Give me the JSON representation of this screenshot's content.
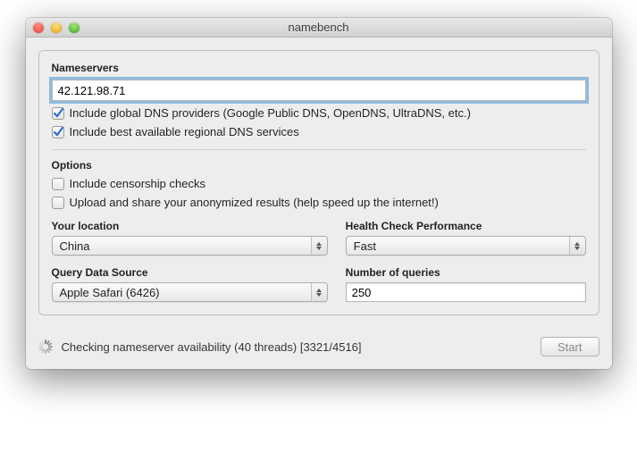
{
  "window": {
    "title": "namebench"
  },
  "nameservers": {
    "label": "Nameservers",
    "value": "42.121.98.71",
    "include_global": {
      "checked": true,
      "label": "Include global DNS providers (Google Public DNS, OpenDNS, UltraDNS, etc.)"
    },
    "include_regional": {
      "checked": true,
      "label": "Include best available regional DNS services"
    }
  },
  "options": {
    "label": "Options",
    "censorship": {
      "checked": false,
      "label": "Include censorship checks"
    },
    "upload": {
      "checked": false,
      "label": "Upload and share your anonymized results (help speed up the internet!)"
    }
  },
  "location": {
    "label": "Your location",
    "value": "China"
  },
  "health": {
    "label": "Health Check Performance",
    "value": "Fast"
  },
  "source": {
    "label": "Query Data Source",
    "value": "Apple Safari (6426)"
  },
  "queries": {
    "label": "Number of queries",
    "value": "250"
  },
  "footer": {
    "status": "Checking nameserver availability (40 threads) [3321/4516]",
    "start": "Start"
  }
}
